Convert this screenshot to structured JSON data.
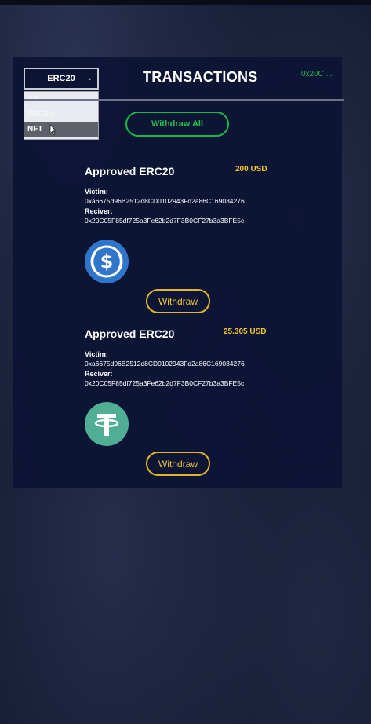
{
  "header": {
    "title": "TRANSACTIONS",
    "address_chip": "0x20C ..."
  },
  "filter": {
    "selected": "ERC20",
    "options": [
      "All",
      "ERC20",
      "NFT"
    ],
    "highlighted_index": 2
  },
  "withdraw_all_label": "Withdraw All",
  "transactions": [
    {
      "title": "Approved ERC20",
      "amount": "200 USD",
      "victim_label": "Victim:",
      "victim": "0xa6675d96B2512d8CD0102943Fd2a86C169034276",
      "receiver_label": "Reciver:",
      "receiver": "0x20C05F85df725a3Fe62b2d7F3B0CF27b3a3BFE5c",
      "token_icon": "usdc-icon",
      "withdraw_label": "Withdraw"
    },
    {
      "title": "Approved ERC20",
      "amount": "25.305 USD",
      "victim_label": "Victim:",
      "victim": "0xa6675d96B2512d8CD0102943Fd2a86C169034276",
      "receiver_label": "Reciver:",
      "receiver": "0x20C05F85df725a3Fe62b2d7F3B0CF27b3a3BFE5c",
      "token_icon": "usdt-icon",
      "withdraw_label": "Withdraw"
    }
  ],
  "colors": {
    "accent_green": "#23c24d",
    "accent_gold": "#f1c734",
    "panel_bg": "#0c1434",
    "usdc_blue": "#2f75c9",
    "usdt_green": "#50ae94"
  }
}
